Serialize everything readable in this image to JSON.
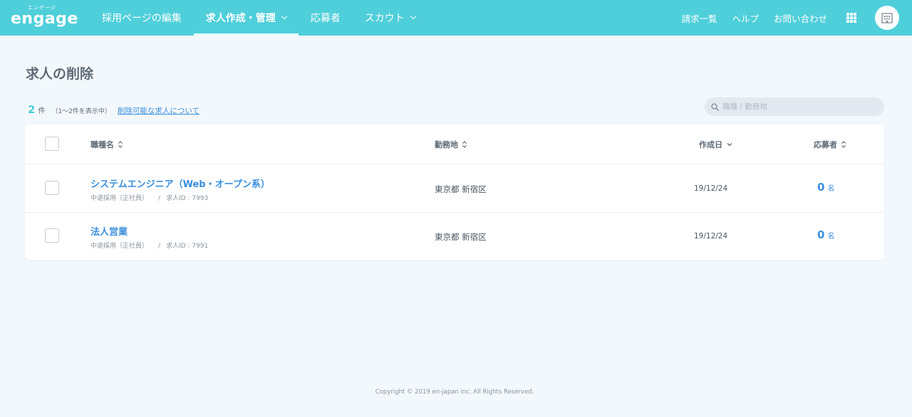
{
  "header": {
    "logo_sub": "エンゲージ",
    "logo_main": "engage",
    "nav": [
      {
        "label": "採用ページの編集"
      },
      {
        "label": "求人作成・管理"
      },
      {
        "label": "応募者"
      },
      {
        "label": "スカウト"
      }
    ],
    "right": {
      "billing": "請求一覧",
      "help": "ヘルプ",
      "contact": "お問い合わせ"
    }
  },
  "page": {
    "title": "求人の削除"
  },
  "summary": {
    "count": "2",
    "unit": "件",
    "range": "（1〜2件を表示中）",
    "link": "削除可能な求人について"
  },
  "search": {
    "placeholder": "職種 / 勤務地"
  },
  "table": {
    "headers": {
      "job": "職種名",
      "location": "勤務地",
      "created": "作成日",
      "applicants": "応募者"
    },
    "rows": [
      {
        "title": "システムエンジニア（Web・オープン系）",
        "type": "中途採用（正社員）",
        "sep": "/",
        "id_label": "求人ID : 7993",
        "location": "東京都 新宿区",
        "date": "19/12/24",
        "applicants": "0",
        "unit": "名"
      },
      {
        "title": "法人営業",
        "type": "中途採用（正社員）",
        "sep": "/",
        "id_label": "求人ID : 7991",
        "location": "東京都 新宿区",
        "date": "19/12/24",
        "applicants": "0",
        "unit": "名"
      }
    ]
  },
  "footer": {
    "copyright": "Copyright © 2019 en-japan inc. All Rights Reserved."
  },
  "colors": {
    "header_bg": "#4fcfda",
    "link": "#3a8edb",
    "accent_count": "#4fcfda",
    "page_bg": "#f3f8fd"
  }
}
